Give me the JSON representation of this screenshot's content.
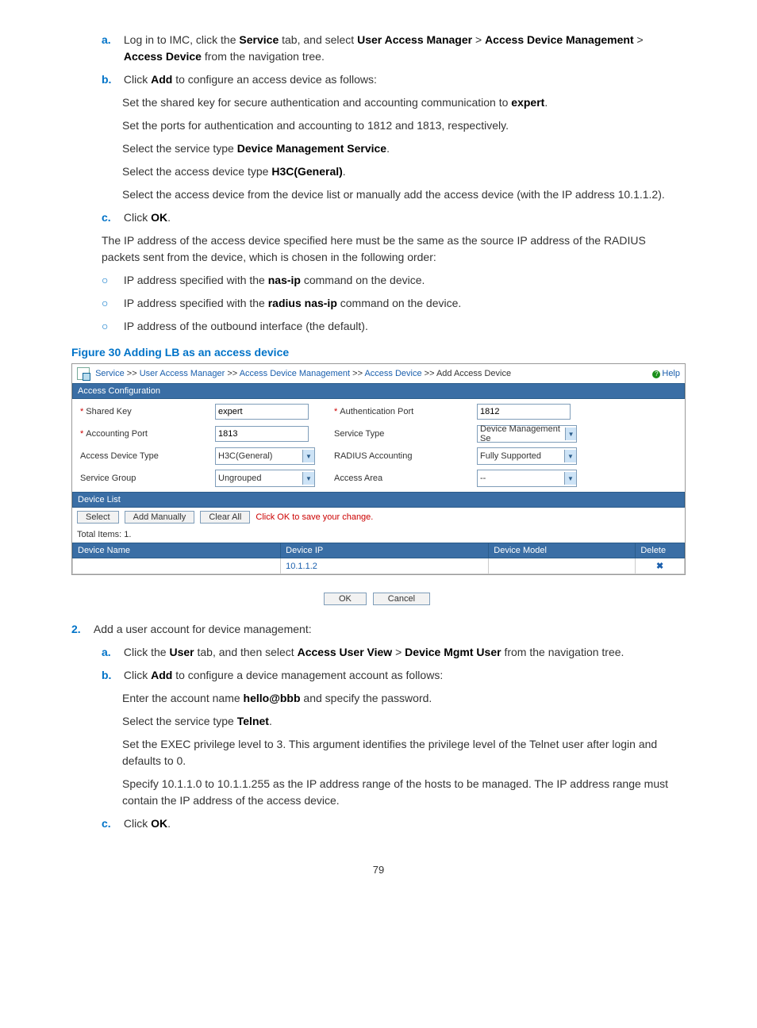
{
  "step1": {
    "a": {
      "marker": "a.",
      "t1": "Log in to IMC, click the ",
      "b1": "Service",
      "t2": " tab, and select ",
      "b2": "User Access Manager",
      "t3": " > ",
      "b3": "Access Device Management",
      "t4": " > ",
      "b4": "Access Device",
      "t5": " from the navigation tree."
    },
    "b": {
      "marker": "b.",
      "t1": "Click ",
      "b1": "Add",
      "t2": " to configure an access device as follows:"
    },
    "b_sub1": {
      "t1": "Set the shared key for secure authentication and accounting communication to ",
      "b1": "expert",
      "t2": "."
    },
    "b_sub2": "Set the ports for authentication and accounting to 1812 and 1813, respectively.",
    "b_sub3": {
      "t1": "Select the service type ",
      "b1": "Device Management Service",
      "t2": "."
    },
    "b_sub4": {
      "t1": "Select the access device type ",
      "b1": "H3C(General)",
      "t2": "."
    },
    "b_sub5": "Select the access device from the device list or manually add the access device (with the IP address 10.1.1.2).",
    "c": {
      "marker": "c.",
      "t1": "Click ",
      "b1": "OK",
      "t2": "."
    },
    "para": "The IP address of the access device specified here must be the same as the source IP address of the RADIUS packets sent from the device, which is chosen in the following order:",
    "o1": {
      "t1": "IP address specified with the ",
      "b1": "nas-ip",
      "t2": " command on the device."
    },
    "o2": {
      "t1": "IP address specified with the ",
      "b1": "radius nas-ip",
      "t2": " command on the device."
    },
    "o3": "IP address of the outbound interface (the default)."
  },
  "figure": {
    "caption": "Figure 30 Adding LB as an access device"
  },
  "shot": {
    "crumb": {
      "c1": "Service",
      "c2": "User Access Manager",
      "c3": "Access Device Management",
      "c4": "Access Device",
      "c5": "Add Access Device",
      "sep": " >> "
    },
    "help": "Help",
    "section1": "Access Configuration",
    "labels": {
      "shared": "Shared Key",
      "authport": "Authentication Port",
      "acctport": "Accounting Port",
      "svctype": "Service Type",
      "devtype": "Access Device Type",
      "radacct": "RADIUS Accounting",
      "svcgroup": "Service Group",
      "area": "Access Area"
    },
    "vals": {
      "shared": "expert",
      "authport": "1812",
      "acctport": "1813",
      "svctype": "Device Management Se",
      "devtype": "H3C(General)",
      "radacct": "Fully Supported",
      "svcgroup": "Ungrouped",
      "area": "--"
    },
    "section2": "Device List",
    "btns": {
      "select": "Select",
      "addman": "Add Manually",
      "clear": "Clear All"
    },
    "note": "Click OK to save your change.",
    "total": "Total Items: 1.",
    "thead": {
      "name": "Device Name",
      "ip": "Device IP",
      "model": "Device Model",
      "del": "Delete"
    },
    "row": {
      "name": "",
      "ip": "10.1.1.2",
      "model": "",
      "del": "✖"
    },
    "ok": "OK",
    "cancel": "Cancel"
  },
  "step2": {
    "marker": "2.",
    "intro": "Add a user account for device management:",
    "a": {
      "marker": "a.",
      "t1": "Click the ",
      "b1": "User",
      "t2": " tab, and then select ",
      "b2": "Access User View",
      "t3": " > ",
      "b3": "Device Mgmt User",
      "t4": " from the navigation tree."
    },
    "b": {
      "marker": "b.",
      "t1": "Click ",
      "b1": "Add",
      "t2": " to configure a device management account as follows:"
    },
    "b_sub1": {
      "t1": "Enter the account name ",
      "b1": "hello@bbb",
      "t2": " and specify the password."
    },
    "b_sub2": {
      "t1": "Select the service type ",
      "b1": "Telnet",
      "t2": "."
    },
    "b_sub3": "Set the EXEC privilege level to 3. This argument identifies the privilege level of the Telnet user after login and defaults to 0.",
    "b_sub4": "Specify 10.1.1.0 to 10.1.1.255 as the IP address range of the hosts to be managed. The IP address range must contain the IP address of the access device.",
    "c": {
      "marker": "c.",
      "t1": "Click ",
      "b1": "OK",
      "t2": "."
    }
  },
  "page": "79"
}
